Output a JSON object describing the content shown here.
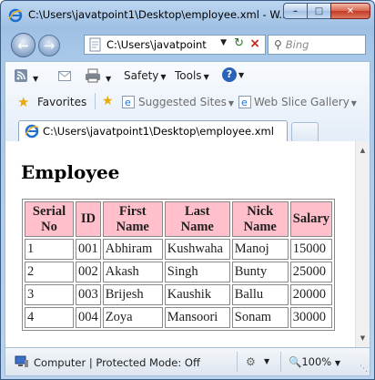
{
  "window": {
    "title": "C:\\Users\\javatpoint1\\Desktop\\employee.xml - W...",
    "minimize_label": "–",
    "maximize_label": "□",
    "close_label": "✕"
  },
  "nav": {
    "back_icon": "back-arrow-icon",
    "forward_icon": "forward-arrow-icon",
    "address_value": "C:\\Users\\javatpoint",
    "search_placeholder": "Bing"
  },
  "commandbar": {
    "safety_label": "Safety",
    "tools_label": "Tools",
    "help_label": "?"
  },
  "favorites_bar": {
    "favorites_label": "Favorites",
    "suggested_label": "Suggested Sites",
    "webslice_label": "Web Slice Gallery"
  },
  "tab": {
    "label": "C:\\Users\\javatpoint1\\Desktop\\employee.xml"
  },
  "page": {
    "heading": "Employee",
    "table": {
      "headers": [
        [
          "Serial",
          "No"
        ],
        [
          "ID"
        ],
        [
          "First",
          "Name"
        ],
        [
          "Last",
          "Name"
        ],
        [
          "Nick",
          "Name"
        ],
        [
          "Salary"
        ]
      ],
      "rows": [
        [
          "1",
          "001",
          "Abhiram",
          "Kushwaha",
          "Manoj",
          "15000"
        ],
        [
          "2",
          "002",
          "Akash",
          "Singh",
          "Bunty",
          "25000"
        ],
        [
          "3",
          "003",
          "Brijesh",
          "Kaushik",
          "Ballu",
          "20000"
        ],
        [
          "4",
          "004",
          "Zoya",
          "Mansoori",
          "Sonam",
          "30000"
        ]
      ]
    }
  },
  "status": {
    "text": "Computer | Protected Mode: Off",
    "zoom": "100%"
  },
  "colors": {
    "header_bg": "#ffc0cb",
    "frame": "#a8c8ea"
  }
}
